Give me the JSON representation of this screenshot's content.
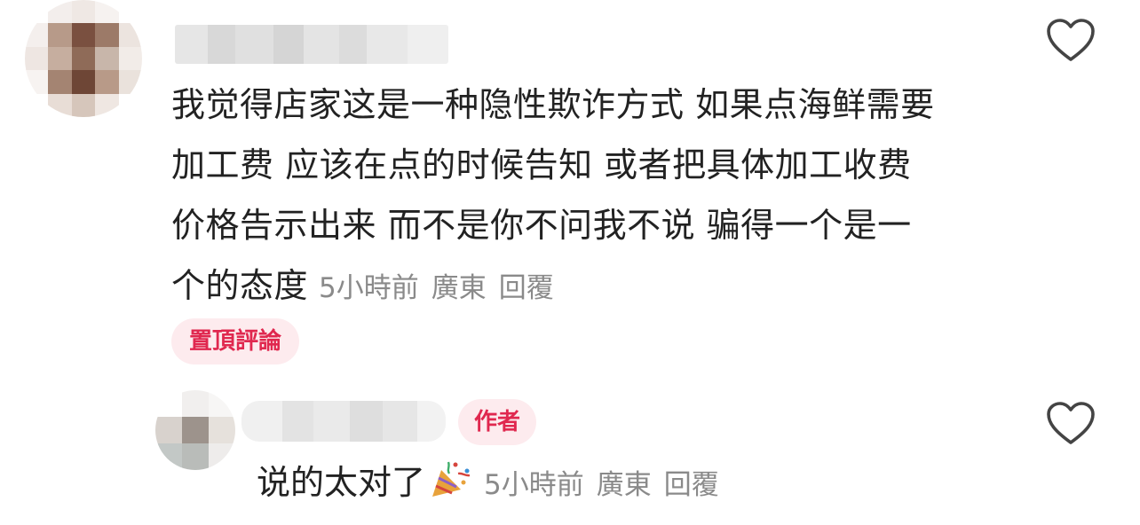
{
  "comment": {
    "lines": [
      "我觉得店家这是一种隐性欺诈方式 如果点海鲜需要",
      "加工费 应该在点的时候告知 或者把具体加工收费",
      "价格告示出来 而不是你不问我不说 骗得一个是一",
      "个的态度"
    ],
    "time": "5小時前",
    "location": "廣東",
    "reply_label": "回覆",
    "pinned_label": "置頂評論",
    "like_icon": "heart-outline-icon"
  },
  "reply": {
    "text": "说的太对了",
    "emoji_icon": "party-popper-icon",
    "author_badge": "作者",
    "time": "5小時前",
    "location": "廣東",
    "reply_label": "回覆",
    "like_icon": "heart-outline-icon"
  },
  "colors": {
    "text": "#222222",
    "meta": "#8a8a8a",
    "accent": "#e0284f",
    "badge_bg": "#fdebee",
    "icon_stroke": "#444444"
  }
}
